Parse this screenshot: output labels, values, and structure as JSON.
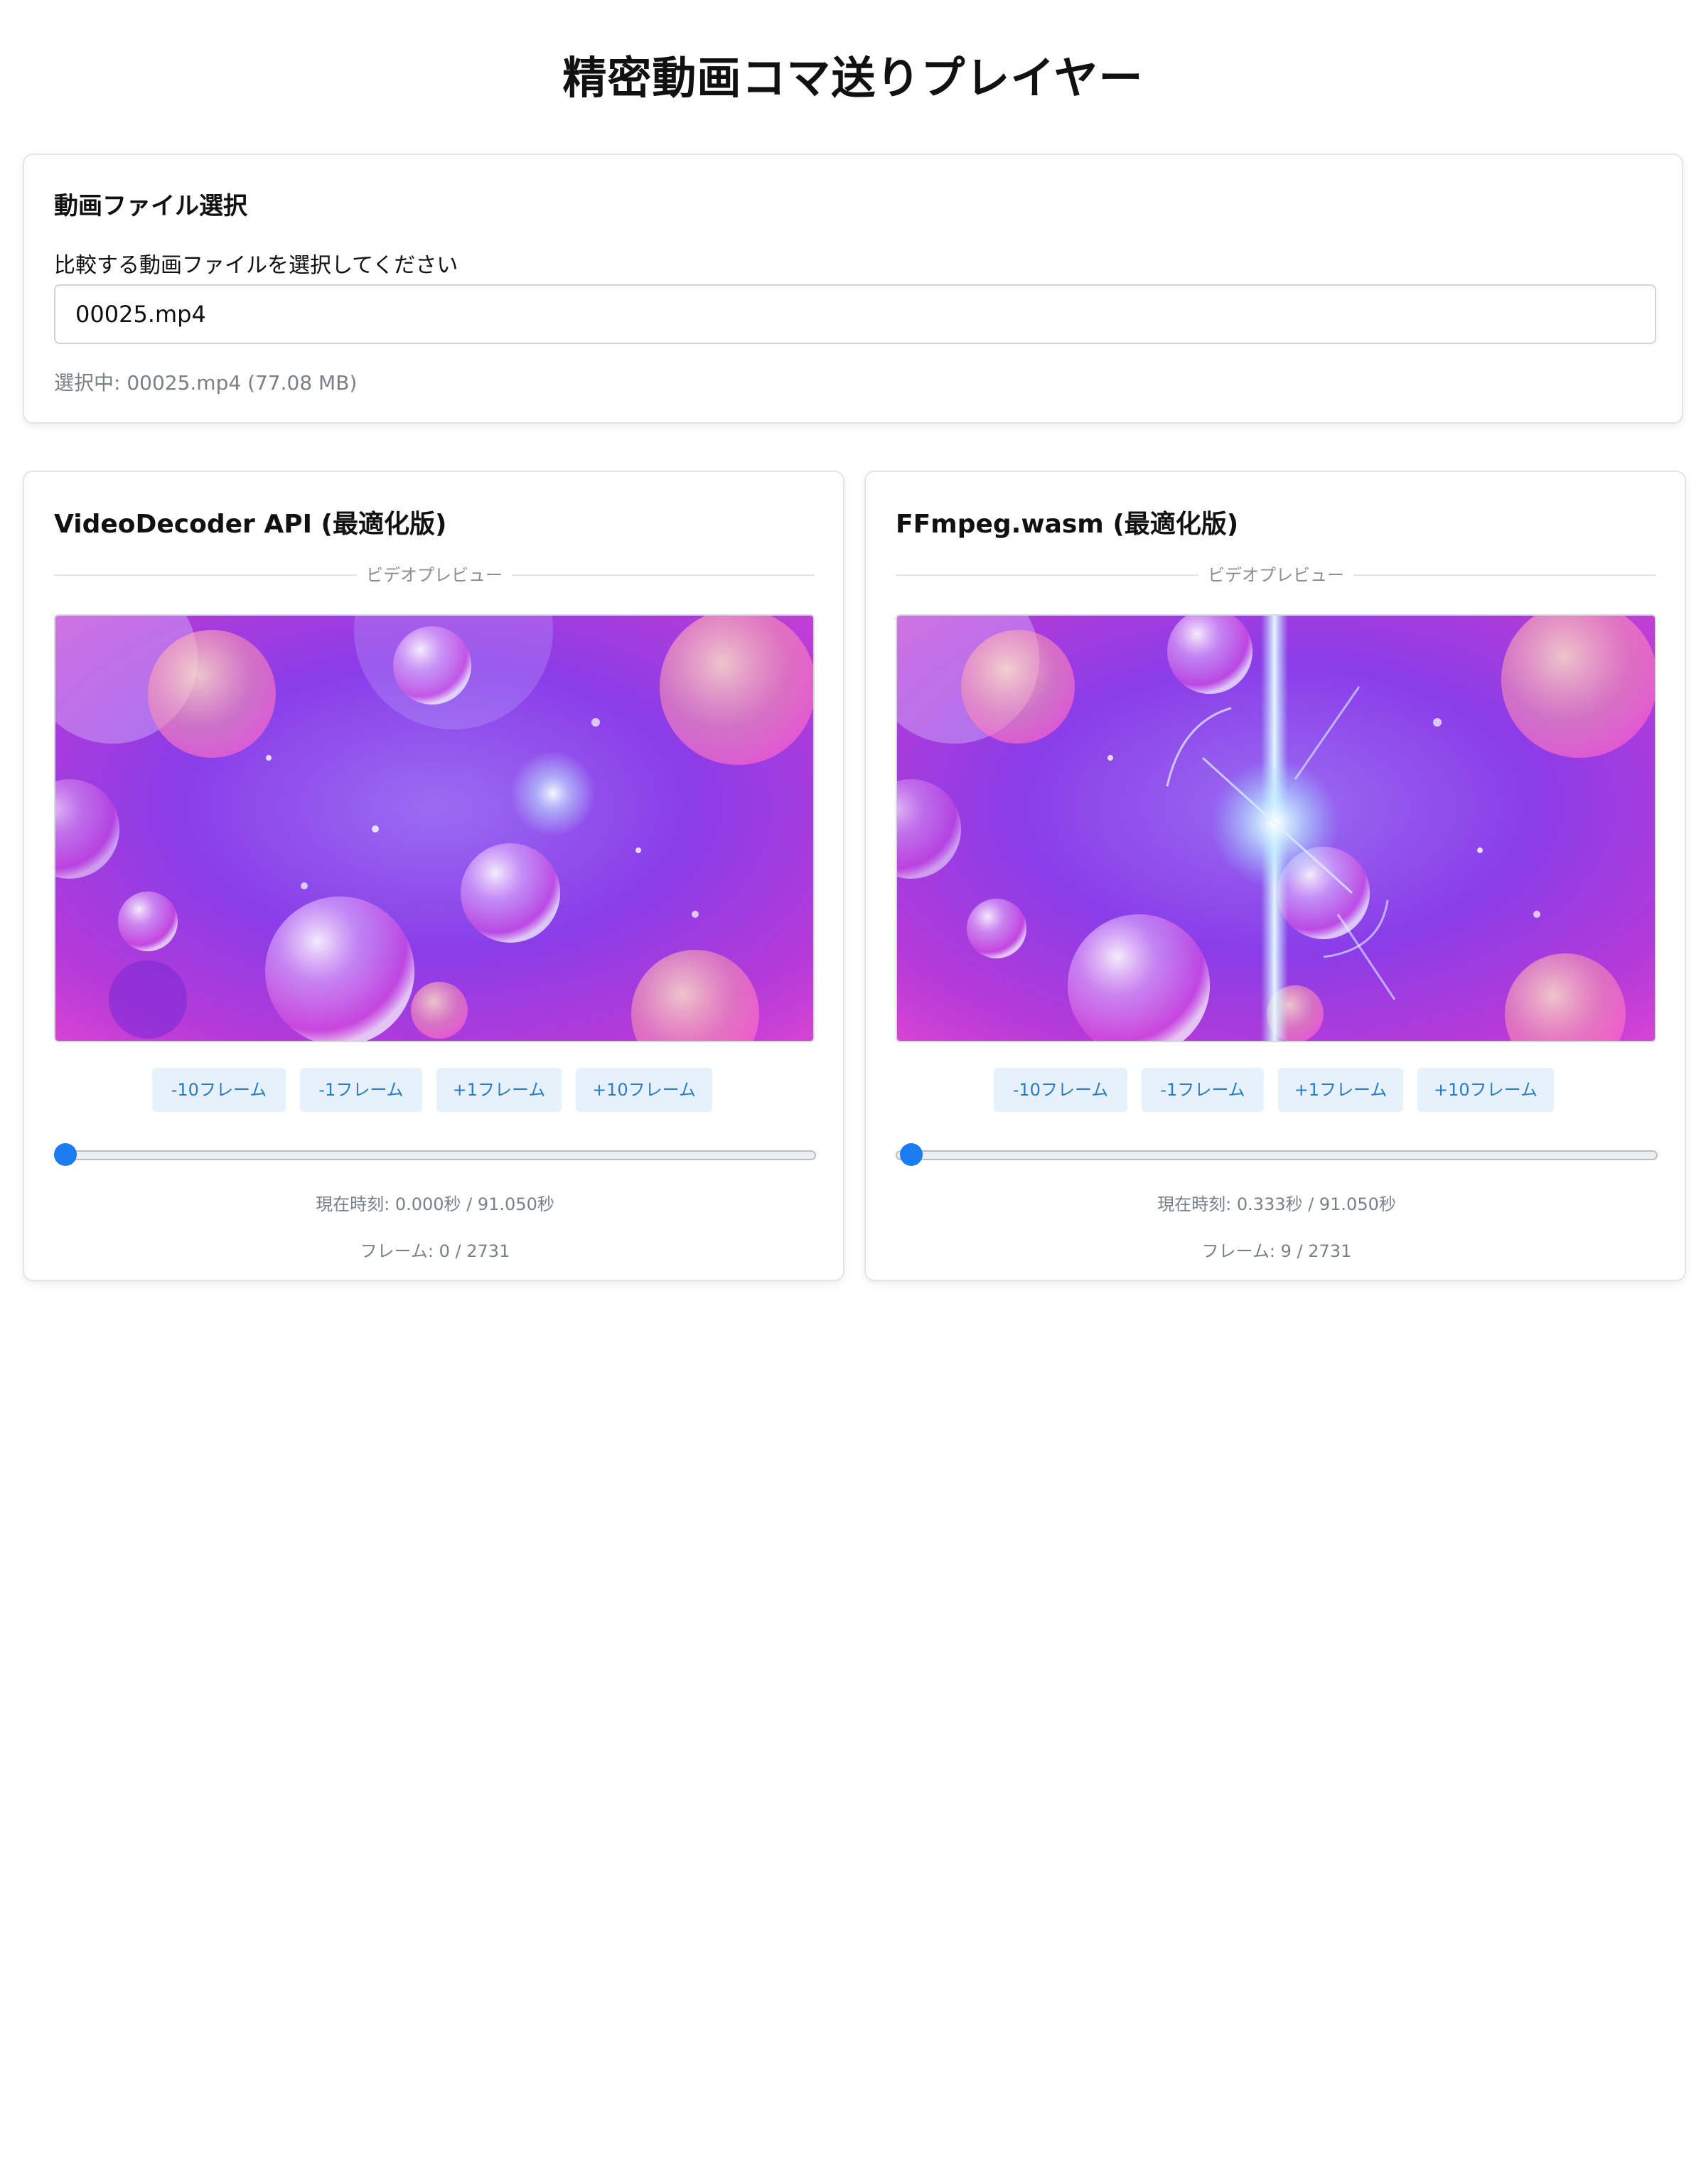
{
  "page": {
    "title": "精密動画コマ送りプレイヤー"
  },
  "file_section": {
    "title": "動画ファイル選択",
    "label": "比較する動画ファイルを選択してください",
    "input_value": "00025.mp4",
    "selected_info": "選択中: 00025.mp4 (77.08 MB)"
  },
  "players": [
    {
      "title": "VideoDecoder API (最適化版)",
      "preview_label": "ビデオプレビュー",
      "buttons": [
        "-10フレーム",
        "-1フレーム",
        "+1フレーム",
        "+10フレーム"
      ],
      "slider_value": 0.0,
      "time_text": "現在時刻: 0.000秒 / 91.050秒",
      "frame_text": "フレーム: 0 / 2731"
    },
    {
      "title": "FFmpeg.wasm (最適化版)",
      "preview_label": "ビデオプレビュー",
      "buttons": [
        "-10フレーム",
        "-1フレーム",
        "+1フレーム",
        "+10フレーム"
      ],
      "slider_value": 0.333,
      "time_text": "現在時刻: 0.333秒 / 91.050秒",
      "frame_text": "フレーム: 9 / 2731"
    }
  ],
  "colors": {
    "accent": "#1a7cf0",
    "button_bg": "#e6f1fb",
    "button_text": "#2a7dc4",
    "muted_text": "#7a8088"
  }
}
